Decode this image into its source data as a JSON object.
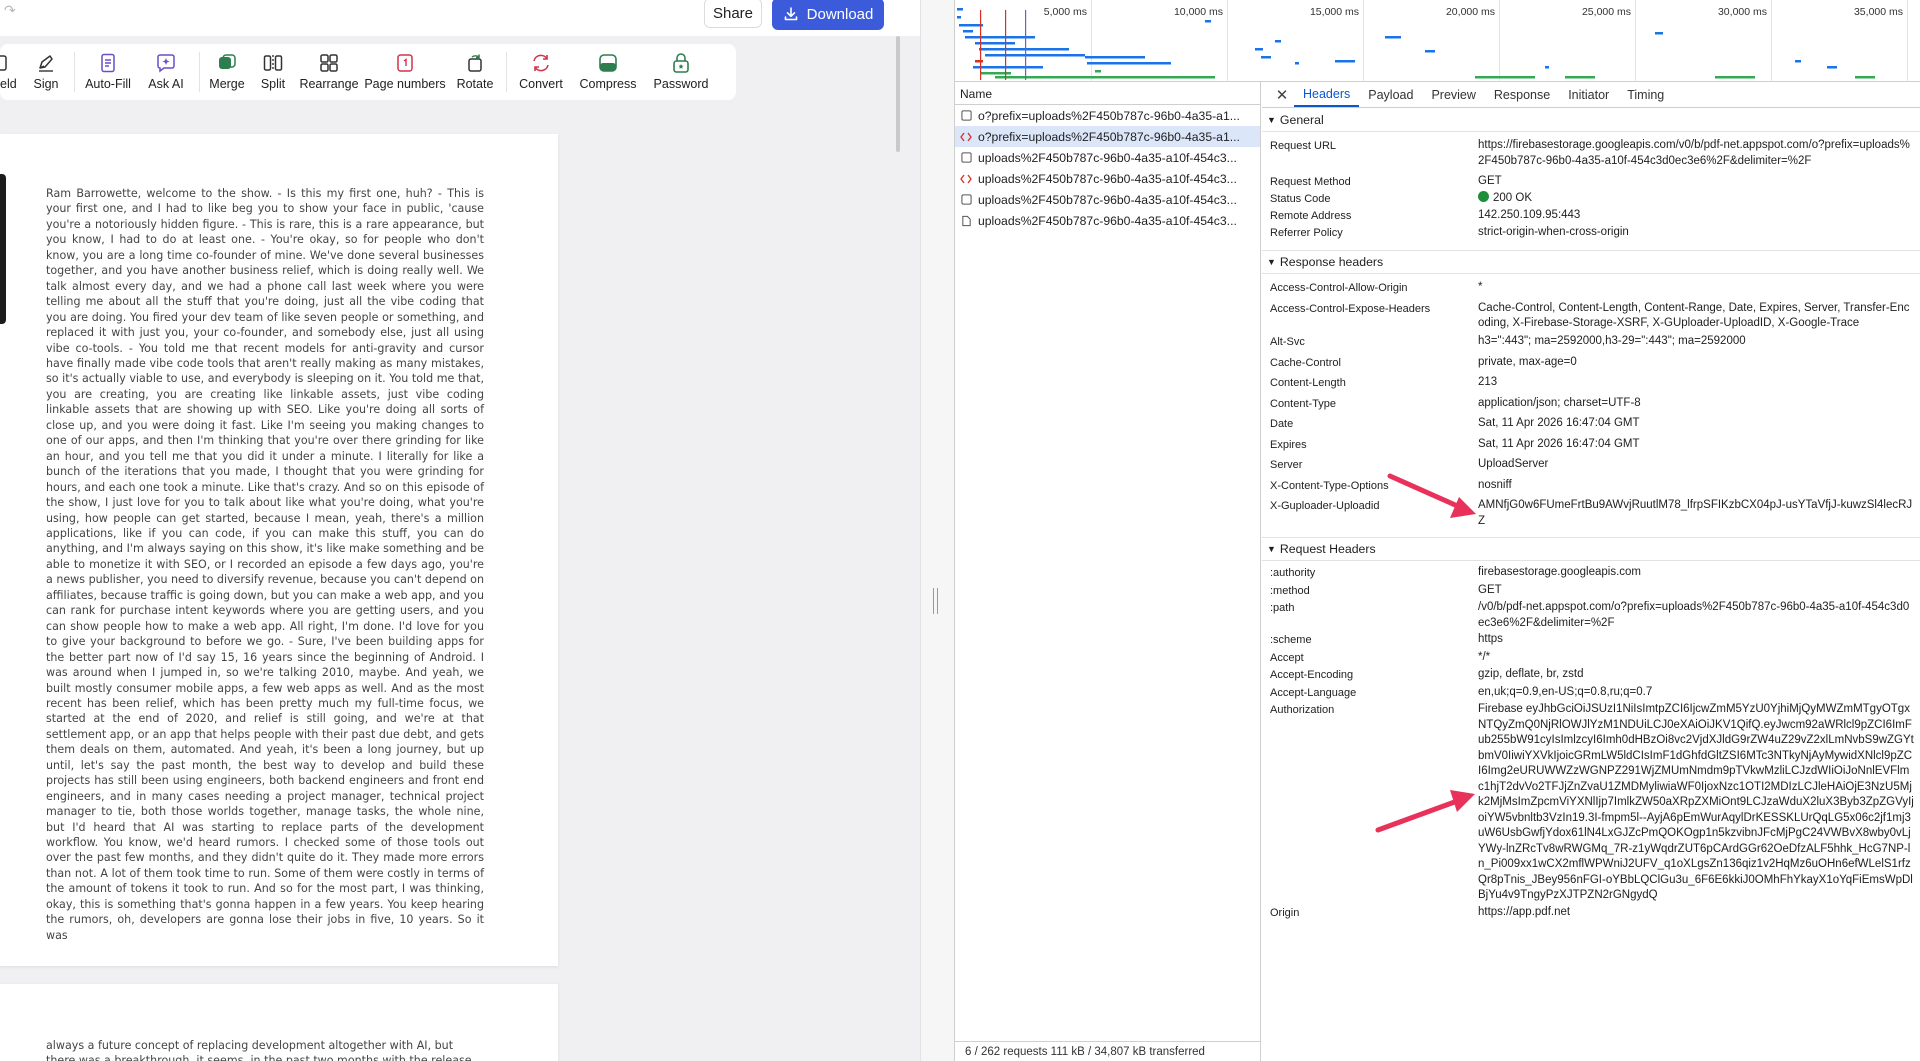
{
  "editor": {
    "share_label": "Share",
    "download_label": "Download",
    "tools": [
      {
        "label": "eld",
        "icon": "field-icon"
      },
      {
        "label": "Sign",
        "icon": "pen-icon"
      },
      {
        "label": "Auto-Fill",
        "icon": "document-icon"
      },
      {
        "label": "Ask AI",
        "icon": "chat-sparkle-icon"
      },
      {
        "label": "Merge",
        "icon": "merge-icon"
      },
      {
        "label": "Split",
        "icon": "split-icon"
      },
      {
        "label": "Rearrange",
        "icon": "grid-icon"
      },
      {
        "label": "Page numbers",
        "icon": "page-number-icon"
      },
      {
        "label": "Rotate",
        "icon": "rotate-icon"
      },
      {
        "label": "Convert",
        "icon": "convert-icon"
      },
      {
        "label": "Compress",
        "icon": "compress-icon"
      },
      {
        "label": "Password",
        "icon": "lock-icon"
      }
    ],
    "page1_text": "Ram Barrowette, welcome to the show. - Is this my first one, huh? - This is your first one, and I had to like beg you to show your face in public, 'cause you're a notoriously hidden figure. - This is rare, this is a rare appearance, but you know, I had to do at least one. - You're okay, so for people who don't know, you are a long time co-founder of mine. We've done several businesses together, and you have another business relief, which is doing really well. We talk almost every day, and we had a phone call last week where you were telling me about all the stuff that you're doing, just all the vibe coding that you are doing. You fired your dev team of like seven people or something, and replaced it with just you, your co-founder, and somebody else, just all using vibe co-tools. - You told me that recent models for anti-gravity and cursor have finally made vibe code tools that aren't really making as many mistakes, so it's actually viable to use, and everybody is sleeping on it. You told me that, you are creating, you are creating like linkable assets, just vibe coding linkable assets that are showing up with SEO. Like you're doing all sorts of close up, and you were doing it fast. Like I'm seeing you making changes to one of our apps, and then I'm thinking that you're over there grinding for like an hour, and you tell me that you did it under a minute. I literally for like a bunch of the iterations that you made, I thought that you were grinding for hours, and each one took a minute. Like that's crazy. And so on this episode of the show, I just love for you to talk about like what you're doing, what you're using, how people can get started, because I mean, yeah, there's a million applications, like if you can code, if you can make this stuff, you can do anything, and I'm always saying on this show, it's like make something and be able to monetize it with SEO, or I recorded an episode a few days ago, you're a news publisher, you need to diversify revenue, because you can't depend on affiliates, because traffic is going down, but you can make a web app, and you can rank for purchase intent keywords where you are getting users, and you can show people how to make a web app. All right, I'm done. I'd love for you to give your background to before we go. - Sure, I've been building apps for the better part now of I'd say 15, 16 years since the beginning of Android. I was around when I jumped in, so we're talking 2010, maybe. And yeah, we built mostly consumer mobile apps, a few web apps as well. And as the most recent has been relief, which has been pretty much my full-time focus, we started at the end of 2020, and relief is still going, and we're at that settlement app, or an app that helps people with their past due debt, and gets them deals on them, automated. And yeah, it's been a long journey, but up until, let's say the past month, the best way to develop and build these projects has still been using engineers, both backend engineers and front end engineers, and in many cases needing a project manager, technical project manager to tie, both those worlds together, manage tasks, the whole nine, but I'd heard that AI was starting to replace parts of the development workflow. You know, we'd heard rumors. I checked some of those tools out over the past few months, and they didn't quite do it. They made more errors than not. A lot of them took time to run. Some of them were costly in terms of the amount of tokens it took to run. And so for the most part, I was thinking, okay, this is something that's gonna happen in a few years. You keep hearing the rumors, oh, developers are gonna lose their jobs in five, 10 years. So it was",
    "page2_text": "always a future concept of replacing development altogether with AI, but there was a breakthrough, it seems, in the past two months with the release of"
  },
  "devtools": {
    "timeline_ticks": [
      "5,000 ms",
      "10,000 ms",
      "15,000 ms",
      "20,000 ms",
      "25,000 ms",
      "30,000 ms",
      "35,000 ms"
    ],
    "name_header": "Name",
    "requests": [
      {
        "name": "o?prefix=uploads%2F450b787c-96b0-4a35-a1...",
        "icon": "checkbox-icon",
        "selected": false
      },
      {
        "name": "o?prefix=uploads%2F450b787c-96b0-4a35-a1...",
        "icon": "xhr-icon",
        "selected": true
      },
      {
        "name": "uploads%2F450b787c-96b0-4a35-a10f-454c3...",
        "icon": "checkbox-icon",
        "selected": false
      },
      {
        "name": "uploads%2F450b787c-96b0-4a35-a10f-454c3...",
        "icon": "xhr-icon",
        "selected": false
      },
      {
        "name": "uploads%2F450b787c-96b0-4a35-a10f-454c3...",
        "icon": "checkbox-icon",
        "selected": false
      },
      {
        "name": "uploads%2F450b787c-96b0-4a35-a10f-454c3...",
        "icon": "document-icon",
        "selected": false
      }
    ],
    "status_bar": "6 / 262 requests    111 kB / 34,807 kB transferred",
    "tabs": [
      "Headers",
      "Payload",
      "Preview",
      "Response",
      "Initiator",
      "Timing"
    ],
    "active_tab": "Headers",
    "general_title": "General",
    "general": [
      {
        "k": "Request URL",
        "v": "https://firebasestorage.googleapis.com/v0/b/pdf-net.appspot.com/o?prefix=uploads%2F450b787c-96b0-4a35-a10f-454c3d0ec3e6%2F&delimiter=%2F"
      },
      {
        "k": "Request Method",
        "v": "GET"
      },
      {
        "k": "Status Code",
        "v": "200 OK"
      },
      {
        "k": "Remote Address",
        "v": "142.250.109.95:443"
      },
      {
        "k": "Referrer Policy",
        "v": "strict-origin-when-cross-origin"
      }
    ],
    "response_title": "Response headers",
    "response": [
      {
        "k": "Access-Control-Allow-Origin",
        "v": "*"
      },
      {
        "k": "Access-Control-Expose-Headers",
        "v": "Cache-Control, Content-Length, Content-Range, Date, Expires, Server, Transfer-Encoding, X-Firebase-Storage-XSRF, X-GUploader-UploadID, X-Google-Trace"
      },
      {
        "k": "Alt-Svc",
        "v": "h3=\":443\"; ma=2592000,h3-29=\":443\"; ma=2592000"
      },
      {
        "k": "Cache-Control",
        "v": "private, max-age=0"
      },
      {
        "k": "Content-Length",
        "v": "213"
      },
      {
        "k": "Content-Type",
        "v": "application/json; charset=UTF-8"
      },
      {
        "k": "Date",
        "v": "Sat, 11 Apr 2026 16:47:04 GMT"
      },
      {
        "k": "Expires",
        "v": "Sat, 11 Apr 2026 16:47:04 GMT"
      },
      {
        "k": "Server",
        "v": "UploadServer"
      },
      {
        "k": "X-Content-Type-Options",
        "v": "nosniff"
      },
      {
        "k": "X-Guploader-Uploadid",
        "v": "AMNfjG0w6FUmeFrtBu9AWvjRuutlM78_lfrpSFIKzbCX04pJ-usYTaVfjJ-kuwzSl4lecRJZ"
      }
    ],
    "request_title": "Request Headers",
    "request": [
      {
        "k": ":authority",
        "v": "firebasestorage.googleapis.com"
      },
      {
        "k": ":method",
        "v": "GET"
      },
      {
        "k": ":path",
        "v": "/v0/b/pdf-net.appspot.com/o?prefix=uploads%2F450b787c-96b0-4a35-a10f-454c3d0ec3e6%2F&delimiter=%2F"
      },
      {
        "k": ":scheme",
        "v": "https"
      },
      {
        "k": "Accept",
        "v": "*/*"
      },
      {
        "k": "Accept-Encoding",
        "v": "gzip, deflate, br, zstd"
      },
      {
        "k": "Accept-Language",
        "v": "en,uk;q=0.9,en-US;q=0.8,ru;q=0.7"
      },
      {
        "k": "Authorization",
        "v": "Firebase eyJhbGciOiJSUzI1NiIsImtpZCI6IjcwZmM5YzU0YjhiMjQyMWZmMTgyOTgxNTQyZmQ0NjRlOWJlYzM1NDUiLCJ0eXAiOiJKV1QifQ.eyJwcm92aWRlcl9pZCI6ImFub255bW91cyIsImlzcyI6Imh0dHBzOi8vc2VjdXJldG9rZW4uZ29vZ2xlLmNvbS9wZGYtbmV0IiwiYXVkIjoicGRmLW5ldCIsImF1dGhfdGltZSI6MTc3NTkyNjAyMywidXNlcl9pZCI6Img2eURUWWZzWGNPZ291WjZMUmNmdm9pTVkwMzliLCJzdWIiOiJoNnlEVFlmc1hjT2dvVo2TFJjZnZvaU1ZMDMyliwiaWF0IjoxNzc1OTI2MDIzLCJleHAiOjE3NzU5Mjk2MjMsImZpcmViYXNlIjp7ImlkZW50aXRpZXMiOnt9LCJzaWduX2luX3Byb3ZpZGVyIjoiYW5vbnltb3VzIn19.3I-fmpm5l--AyjA6pEmWurAqylDrKESSKLUrQqLG5x06c2jf1mj3uW6UsbGwfjYdox61lN4LxGJZcPmQOKOgp1n5kzvibnJFcMjPgC24VWBvX8wby0vLjYWy-lnZRcTv8wRWGMq_7R-z1yWqdrZUT6pCArdGGr62OeDfzALF5hhk_HcG7NP-ln_Pi009xx1wCX2mflWPWniJ2UFV_q1oXLgsZn136qiz1v2HqMz6uOHn6efWLelS1rfzQr8pTnis_JBey956nFGI-oYBbLQClGu3u_6F6E6kkiJ0OMhFhYkayX1oYqFiEmsWpDlBjYu4v9TngyPzXJTPZN2rGNgydQ"
      },
      {
        "k": "Origin",
        "v": "https://app.pdf.net"
      }
    ]
  },
  "colors": {
    "accent": "#3b5bdb",
    "devtools_tab_active": "#0b57d0",
    "status_ok": "#1e8e3e",
    "annotation_arrow": "#e8325a",
    "selected_row": "#dce6f9"
  }
}
